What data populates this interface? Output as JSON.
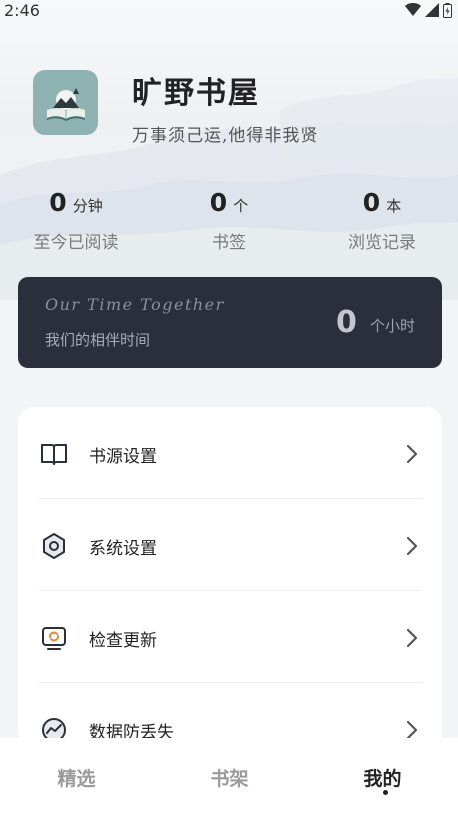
{
  "status_bar": {
    "time": "2:46"
  },
  "app": {
    "title": "旷野书屋",
    "subtitle": "万事须己运,他得非我贤"
  },
  "stats": [
    {
      "value": "0",
      "unit": "分钟",
      "label": "至今已阅读"
    },
    {
      "value": "0",
      "unit": "个",
      "label": "书签"
    },
    {
      "value": "0",
      "unit": "本",
      "label": "浏览记录"
    }
  ],
  "together": {
    "title_en": "Our Time Together",
    "title_cn": "我们的相伴时间",
    "value": "0",
    "unit": "个小时"
  },
  "menu": [
    {
      "label": "书源设置",
      "icon": "book-icon"
    },
    {
      "label": "系统设置",
      "icon": "hexagon-gear-icon"
    },
    {
      "label": "检查更新",
      "icon": "update-icon"
    },
    {
      "label": "数据防丢失",
      "icon": "trend-chart-icon"
    }
  ],
  "bottom_nav": [
    {
      "label": "精选",
      "active": false
    },
    {
      "label": "书架",
      "active": false
    },
    {
      "label": "我的",
      "active": true
    }
  ],
  "colors": {
    "card_dark": "#2b2e3b",
    "logo_bg": "#8fb2b3",
    "page_bg": "#f3f4f6"
  }
}
